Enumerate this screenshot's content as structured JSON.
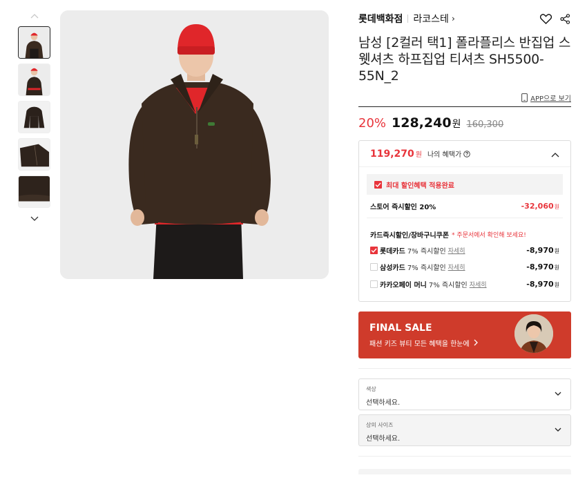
{
  "product": {
    "store": "롯데백화점",
    "brand": "라코스테",
    "brand_chevron": "›",
    "title": "남성 [2컬러 택1] 폴라플리스 반집업 스웻셔츠 하프집업 티셔츠 SH5500-55N_2",
    "app_link": "APP으로 보기",
    "thumbnails_count": 5,
    "active_thumbnail": 0
  },
  "price": {
    "discount_rate": "20%",
    "sale_price": "128,240",
    "won": "원",
    "original_price": "160,300"
  },
  "benefit": {
    "price": "119,270",
    "won": "원",
    "label": "나의 혜택가",
    "applied_text": "최대 할인혜택 적용완료",
    "store_discount_label": "스토어 즉시할인 20%",
    "store_discount_amount": "-32,060",
    "card_title": "카드즉시할인/장바구니쿠폰",
    "card_note": "* 주문서에서 확인해 보세요!",
    "cards": [
      {
        "name": "롯데카드",
        "desc": "7% 즉시할인",
        "detail": "자세히",
        "amount": "-8,970",
        "checked": true
      },
      {
        "name": "삼성카드",
        "desc": "7% 즉시할인",
        "detail": "자세히",
        "amount": "-8,970",
        "checked": false
      },
      {
        "name": "카카오페이 머니",
        "desc": "7% 즉시할인",
        "detail": "자세히",
        "amount": "-8,970",
        "checked": false
      }
    ]
  },
  "banner": {
    "title": "FINAL SALE",
    "subtitle": "패션 키즈 뷰티 모든 혜택을 한눈에",
    "color": "#cf3b2b"
  },
  "options": [
    {
      "label": "색상",
      "value": "선택하세요."
    },
    {
      "label": "상의 사이즈",
      "value": "선택하세요."
    }
  ],
  "colors": {
    "accent_red": "#e8343b",
    "sweater": "#3a2a1f",
    "beanie": "#e0262a"
  },
  "icons": {
    "up": "chevron-up-icon",
    "down": "chevron-down-icon",
    "wishlist": "heart-icon",
    "share": "share-icon",
    "phone": "phone-icon",
    "info": "info-icon"
  }
}
